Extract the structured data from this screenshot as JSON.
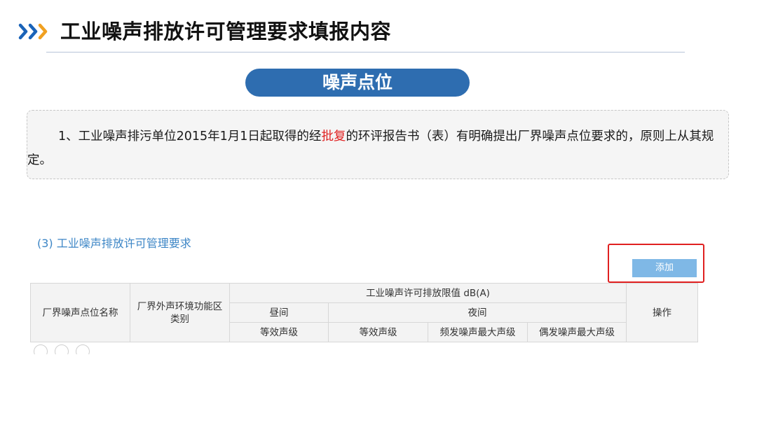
{
  "header": {
    "title": "工业噪声排放许可管理要求填报内容",
    "chevron_icon": "triple-chevron-right-icon",
    "chevron_color": "#1a63b8"
  },
  "section_pill": {
    "label": "噪声点位",
    "color": "#2e6db0"
  },
  "note": {
    "before": "1、工业噪声排污单位2015年1月1日起取得的经",
    "highlight": "批复",
    "after": "的环评报告书（表）有明确提出厂界噪声点位要求的，原则上从其规定。",
    "highlight_color": "#e02020"
  },
  "form": {
    "section_heading": "(3) 工业噪声排放许可管理要求",
    "add_button_label": "添加",
    "table": {
      "col_point_name": "厂界噪声点位名称",
      "col_zone_type": "厂界外声环境功能区类别",
      "group_limit": "工业噪声许可排放限值 dB(A)",
      "sub_day": "昼间",
      "sub_night": "夜间",
      "col_action": "操作",
      "day_equiv": "等效声级",
      "night_equiv": "等效声级",
      "night_freq_max": "频发噪声最大声级",
      "night_occ_max": "偶发噪声最大声级"
    }
  }
}
